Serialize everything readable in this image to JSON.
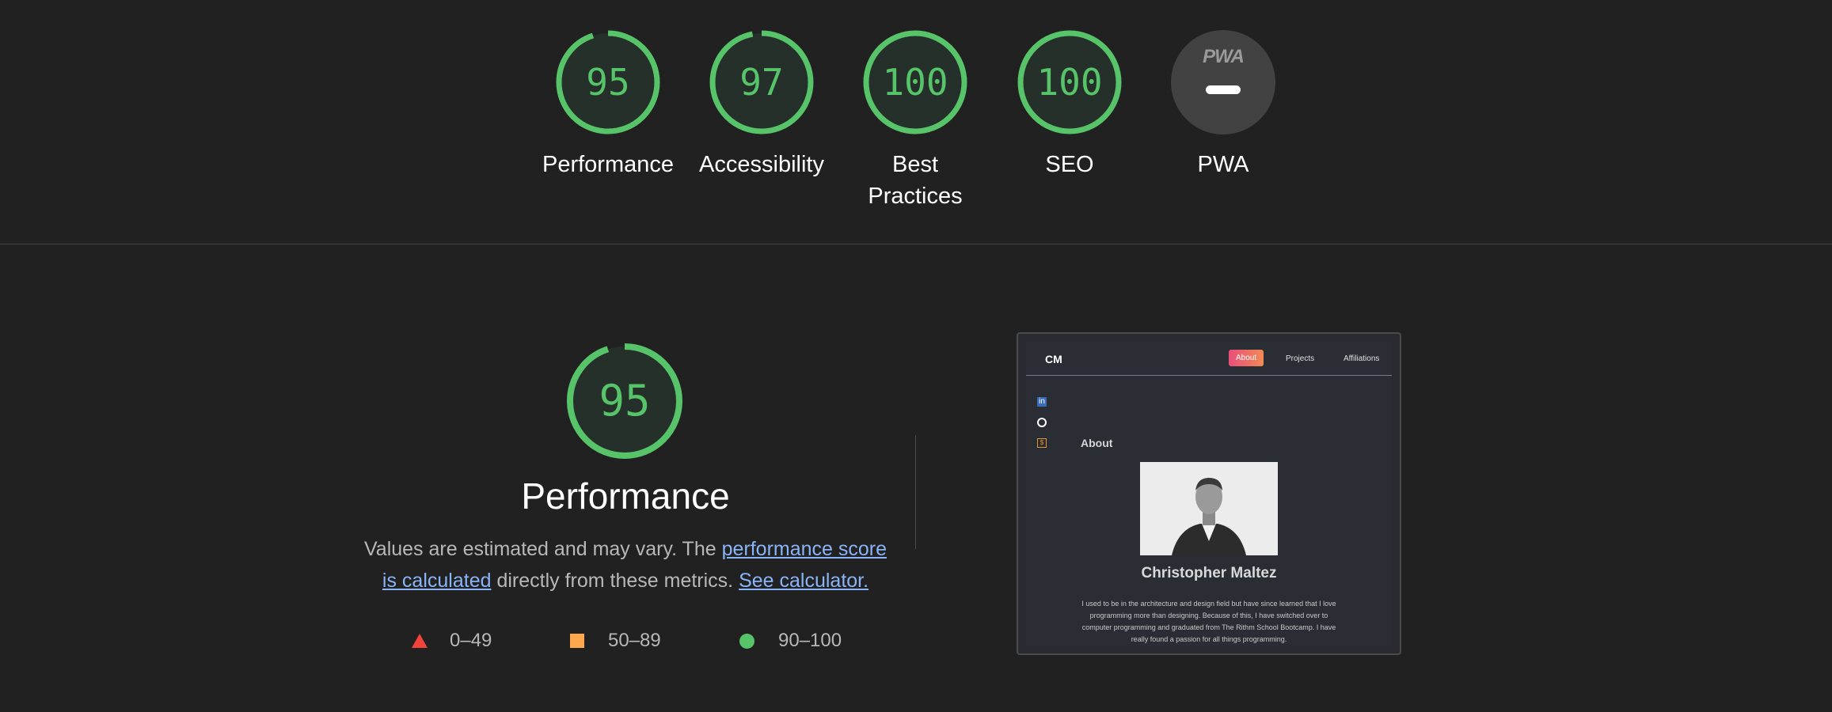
{
  "gauges": [
    {
      "score": "95",
      "label": "Performance",
      "value": 95
    },
    {
      "score": "97",
      "label": "Accessibility",
      "value": 97
    },
    {
      "score": "100",
      "label": "Best Practices",
      "value": 100
    },
    {
      "score": "100",
      "label": "SEO",
      "value": 100
    },
    {
      "score": "",
      "label": "PWA",
      "logo": "PWA",
      "value": null
    }
  ],
  "performance": {
    "score": "95",
    "value": 95,
    "title": "Performance",
    "desc_prefix": "Values are estimated and may vary. The ",
    "link1": "performance score is calculated",
    "desc_mid": " directly from these metrics. ",
    "link2": "See calculator."
  },
  "legend": [
    {
      "range": "0–49",
      "color": "#f4433c",
      "shape": "triangle"
    },
    {
      "range": "50–89",
      "color": "#ffa84d",
      "shape": "square"
    },
    {
      "range": "90–100",
      "color": "#57c46a",
      "shape": "circle"
    }
  ],
  "thumbnail": {
    "brand": "CM",
    "nav": [
      "About",
      "Projects",
      "Affiliations"
    ],
    "active_nav": "About",
    "section_title": "About",
    "name": "Christopher Maltez",
    "bio": "I used to be in the architecture and design field but have since learned that I love programming more than designing. Because of this, I have switched over to computer programming and graduated from The Rithm School Bootcamp. I have really found a passion for all things programming.",
    "social_icons": [
      "linkedin-icon",
      "github-icon",
      "resume-icon"
    ]
  },
  "colors": {
    "background": "#212121",
    "pass": "#57c46a",
    "average": "#ffa84d",
    "fail": "#f4433c",
    "link": "#8ab4f8"
  }
}
